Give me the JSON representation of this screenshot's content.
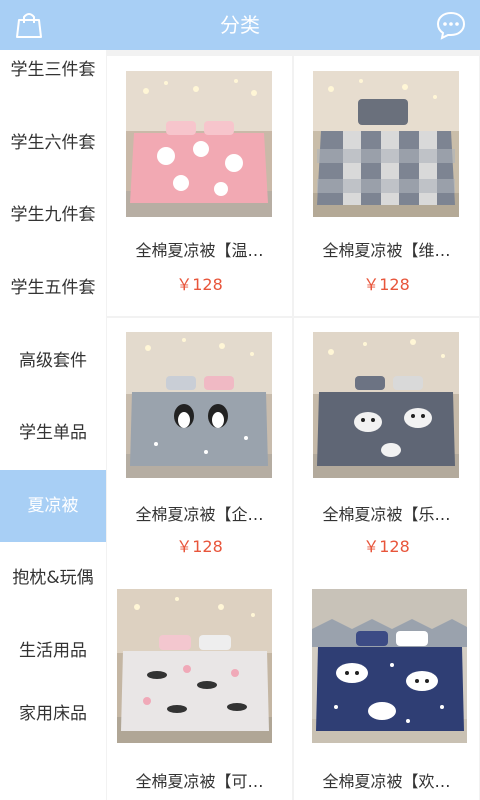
{
  "header": {
    "title": "分类"
  },
  "sidebar": {
    "items": [
      {
        "label": "学生三件套"
      },
      {
        "label": "学生六件套"
      },
      {
        "label": "学生九件套"
      },
      {
        "label": "学生五件套"
      },
      {
        "label": "高级套件"
      },
      {
        "label": "学生单品"
      },
      {
        "label": "夏凉被"
      },
      {
        "label": "抱枕&玩偶"
      },
      {
        "label": "生活用品"
      },
      {
        "label": "家用床品"
      }
    ],
    "active_index": 6
  },
  "products": [
    {
      "name": "全棉夏凉被【温…",
      "price": "￥128",
      "pattern": "pink-floral",
      "color": "#f2a9b3"
    },
    {
      "name": "全棉夏凉被【维…",
      "price": "￥128",
      "pattern": "grey-check",
      "color": "#7d8492"
    },
    {
      "name": "全棉夏凉被【企…",
      "price": "￥128",
      "pattern": "grey-penguin",
      "color": "#9aa3ad"
    },
    {
      "name": "全棉夏凉被【乐…",
      "price": "￥128",
      "pattern": "grey-bear",
      "color": "#5f6675"
    },
    {
      "name": "全棉夏凉被【可…",
      "price": "",
      "pattern": "white-cat",
      "color": "#e9e6e6"
    },
    {
      "name": "全棉夏凉被【欢…",
      "price": "",
      "pattern": "navy-cloud",
      "color": "#2f3e74"
    }
  ],
  "icons": {
    "left": "shopping-bag-icon",
    "right": "chat-bubble-icon"
  },
  "colors": {
    "accent": "#a8cff5",
    "price": "#e8553b"
  }
}
